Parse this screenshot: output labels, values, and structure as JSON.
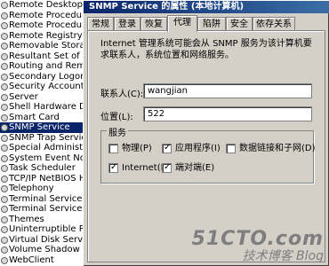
{
  "services": [
    "Remote Desktop Help",
    "Remote Procedure Cal",
    "Remote Procedure Cal",
    "Remote Registry",
    "Removable Storage",
    "Resultant Set of Pol",
    "Routing and Remote A",
    "Secondary Logon",
    "Security Accounts Ma",
    "Server",
    "Shell Hardware Detec",
    "Smart Card",
    "SNMP Service",
    "SNMP Trap Service",
    "Special Administrati",
    "System Event Notific",
    "Task Scheduler",
    "TCP/IP NetBIOS Helpe",
    "Telephony",
    "Terminal Services",
    "Terminal Services Se",
    "Themes",
    "Uninterruptible Powe",
    "Virtual Disk Service",
    "Volume Shadow Copy",
    "WebClient"
  ],
  "dialog": {
    "title": "SNMP Service 的属性 (本地计算机)",
    "tabs": [
      "常规",
      "登录",
      "恢复",
      "代理",
      "陷阱",
      "安全",
      "依存关系"
    ],
    "active_tab": "代理",
    "description": "Internet 管理系统可能会从 SNMP 服务为该计算机要求联系人，系统位置和网络服务。",
    "contact_label": "联系人(C):",
    "contact_value": "wangjian",
    "location_label": "位置(L):",
    "location_value": "522",
    "service_group_title": "服务",
    "checkboxes": {
      "physical": {
        "label": "物理(P)",
        "checked": false
      },
      "applications": {
        "label": "应用程序(I)",
        "checked": true
      },
      "datalink": {
        "label": "数据链接和子网(D)",
        "checked": false
      },
      "internet": {
        "label": "Internet(N)",
        "checked": true
      },
      "endtoend": {
        "label": "端对端(E)",
        "checked": true
      }
    }
  },
  "watermark": {
    "line1": "51CTO.com",
    "line2": "技术博客 Blog"
  }
}
